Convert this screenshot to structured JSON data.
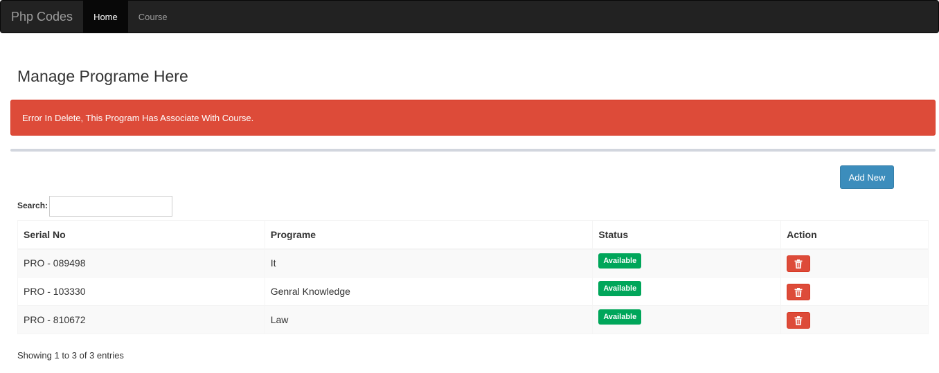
{
  "navbar": {
    "brand": "Php Codes",
    "items": [
      {
        "label": "Home",
        "active": true
      },
      {
        "label": "Course",
        "active": false
      }
    ]
  },
  "page": {
    "title": "Manage Programe Here"
  },
  "alert": {
    "message": "Error In Delete, This Program Has Associate With Course.",
    "color": "#dd4b39"
  },
  "toolbar": {
    "add_label": "Add New",
    "accent": "#3c8dbc"
  },
  "search": {
    "label": "Search:",
    "value": "",
    "placeholder": ""
  },
  "table": {
    "headers": {
      "serial": "Serial No",
      "programe": "Programe",
      "status": "Status",
      "action": "Action"
    },
    "rows": [
      {
        "serial": "PRO - 089498",
        "programe": "It",
        "status": "Available",
        "action_icon": "trash-icon"
      },
      {
        "serial": "PRO - 103330",
        "programe": "Genral Knowledge",
        "status": "Available",
        "action_icon": "trash-icon"
      },
      {
        "serial": "PRO - 810672",
        "programe": "Law",
        "status": "Available",
        "action_icon": "trash-icon"
      }
    ],
    "status_color": "#00a65a",
    "delete_color": "#dd4b39"
  },
  "info": {
    "text": "Showing 1 to 3 of 3 entries"
  }
}
